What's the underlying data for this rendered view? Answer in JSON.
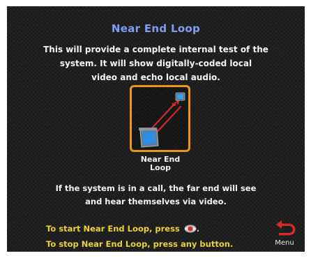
{
  "screen": {
    "title": "Near End Loop",
    "description": [
      "This will provide a complete internal test of the",
      "system.  It will show digitally-coded local",
      "video and echo local audio."
    ],
    "icon_label": [
      "Near End",
      "Loop"
    ],
    "call_note": [
      "If the system is in a call, the far end will see",
      "and hear themselves via video."
    ],
    "instructions": {
      "start": "To start Near End Loop, press",
      "start_suffix": ".",
      "stop": "To stop Near End Loop, press any button."
    },
    "menu_label": "Menu"
  },
  "colors": {
    "title": "#7f9ff2",
    "instruction_text": "#e9d23a",
    "icon_border": "#e49a18",
    "loop_arrows": "#d42a2a",
    "back_arrow": "#d42a2a"
  },
  "icons": {
    "loop_graphic": "near-end-loop-icon",
    "press_button": "select-button-icon",
    "menu_back": "back-arrow-icon"
  }
}
